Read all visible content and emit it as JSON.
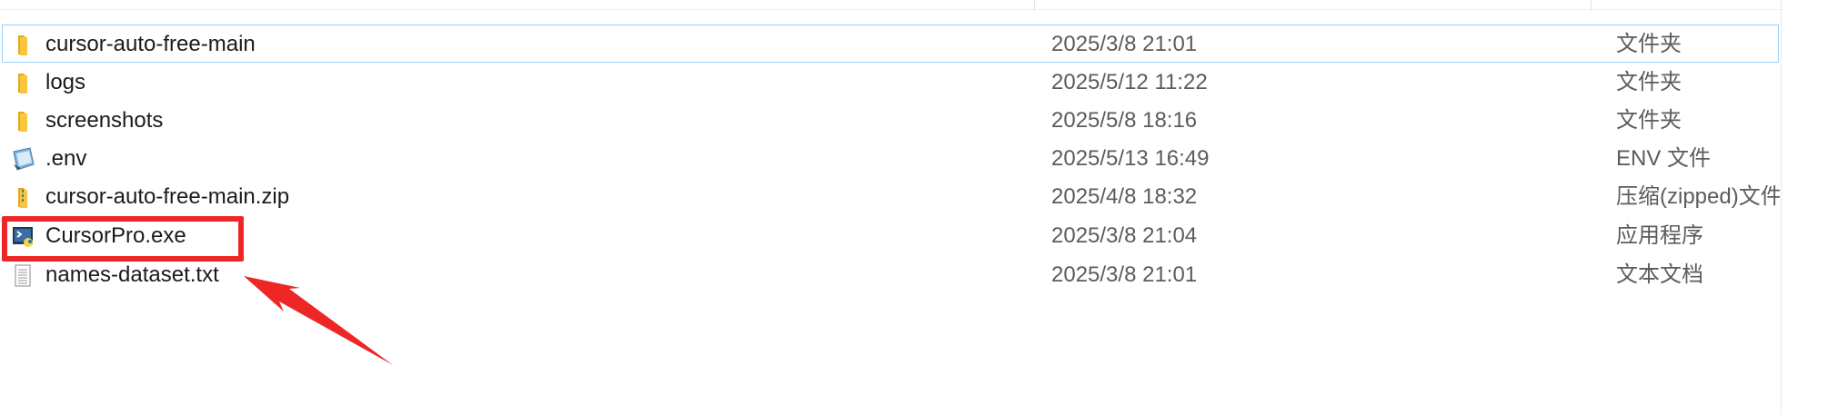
{
  "files": [
    {
      "name": "cursor-auto-free-main",
      "date": "2025/3/8 21:01",
      "type": "文件夹",
      "icon": "folder-icon"
    },
    {
      "name": "logs",
      "date": "2025/5/12 11:22",
      "type": "文件夹",
      "icon": "folder-icon"
    },
    {
      "name": "screenshots",
      "date": "2025/5/8 18:16",
      "type": "文件夹",
      "icon": "folder-icon"
    },
    {
      "name": ".env",
      "date": "2025/5/13 16:49",
      "type": "ENV 文件",
      "icon": "env-file-icon"
    },
    {
      "name": "cursor-auto-free-main.zip",
      "date": "2025/4/8 18:32",
      "type": "压缩(zipped)文件夹",
      "icon": "zip-folder-icon"
    },
    {
      "name": "CursorPro.exe",
      "date": "2025/3/8 21:04",
      "type": "应用程序",
      "icon": "python-exe-icon"
    },
    {
      "name": "names-dataset.txt",
      "date": "2025/3/8 21:01",
      "type": "文本文档",
      "icon": "text-file-icon"
    }
  ],
  "colors": {
    "focus_border": "#99d1ff",
    "annotation_red": "#ee2626",
    "folder_yellow": "#f8c73f"
  }
}
